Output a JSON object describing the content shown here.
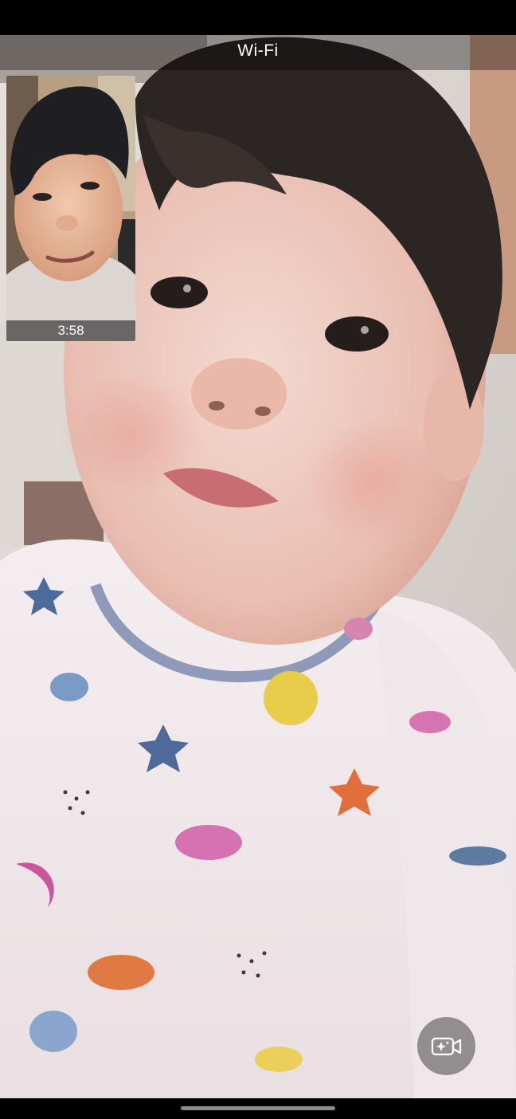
{
  "call": {
    "network_label": "Wi-Fi",
    "timer": "3:58"
  },
  "icons": {
    "effects": "video-effects-sparkle-icon"
  },
  "colors": {
    "background": "#000000",
    "overlay_text": "#ffffff",
    "timer_strip": "#3c3c3c",
    "effects_button": "#464646"
  }
}
